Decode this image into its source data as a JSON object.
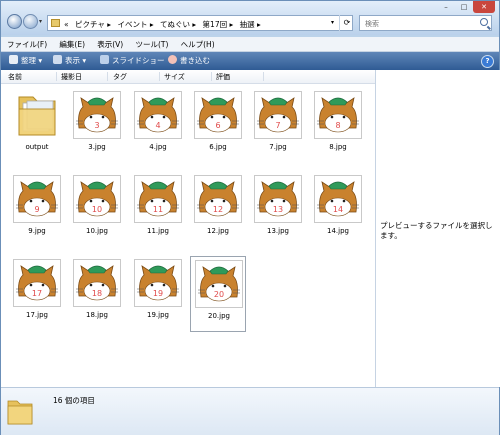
{
  "address": {
    "prefix": "«",
    "crumbs": [
      "ピクチャ ▸",
      "イベント ▸",
      "てぬぐい ▸",
      "第17回 ▸",
      "抽選 ▸"
    ]
  },
  "search": {
    "placeholder": "検索"
  },
  "menu": [
    "ファイル(F)",
    "編集(E)",
    "表示(V)",
    "ツール(T)",
    "ヘルプ(H)"
  ],
  "commands": {
    "organize": "整理 ▾",
    "view": "表示 ▾",
    "slideshow": "スライドショー",
    "burn": "書き込む",
    "help": "?"
  },
  "columns": [
    "名前",
    "撮影日",
    "タグ",
    "サイズ",
    "評価"
  ],
  "files": [
    {
      "name": "output",
      "kind": "folder"
    },
    {
      "name": "3.jpg",
      "num": "3"
    },
    {
      "name": "4.jpg",
      "num": "4"
    },
    {
      "name": "6.jpg",
      "num": "6"
    },
    {
      "name": "7.jpg",
      "num": "7"
    },
    {
      "name": "8.jpg",
      "num": "8"
    },
    {
      "name": "9.jpg",
      "num": "9"
    },
    {
      "name": "10.jpg",
      "num": "10"
    },
    {
      "name": "11.jpg",
      "num": "11"
    },
    {
      "name": "12.jpg",
      "num": "12"
    },
    {
      "name": "13.jpg",
      "num": "13"
    },
    {
      "name": "14.jpg",
      "num": "14"
    },
    {
      "name": "17.jpg",
      "num": "17"
    },
    {
      "name": "18.jpg",
      "num": "18"
    },
    {
      "name": "19.jpg",
      "num": "19"
    },
    {
      "name": "20.jpg",
      "num": "20",
      "selected": true
    }
  ],
  "preview_text": "プレビューするファイルを選択します。",
  "status": {
    "count": "16 個の項目"
  },
  "colors": {
    "cat_body": "#c9822e",
    "hat_green": "#2f9a5a",
    "number_red": "#e04a4a"
  }
}
